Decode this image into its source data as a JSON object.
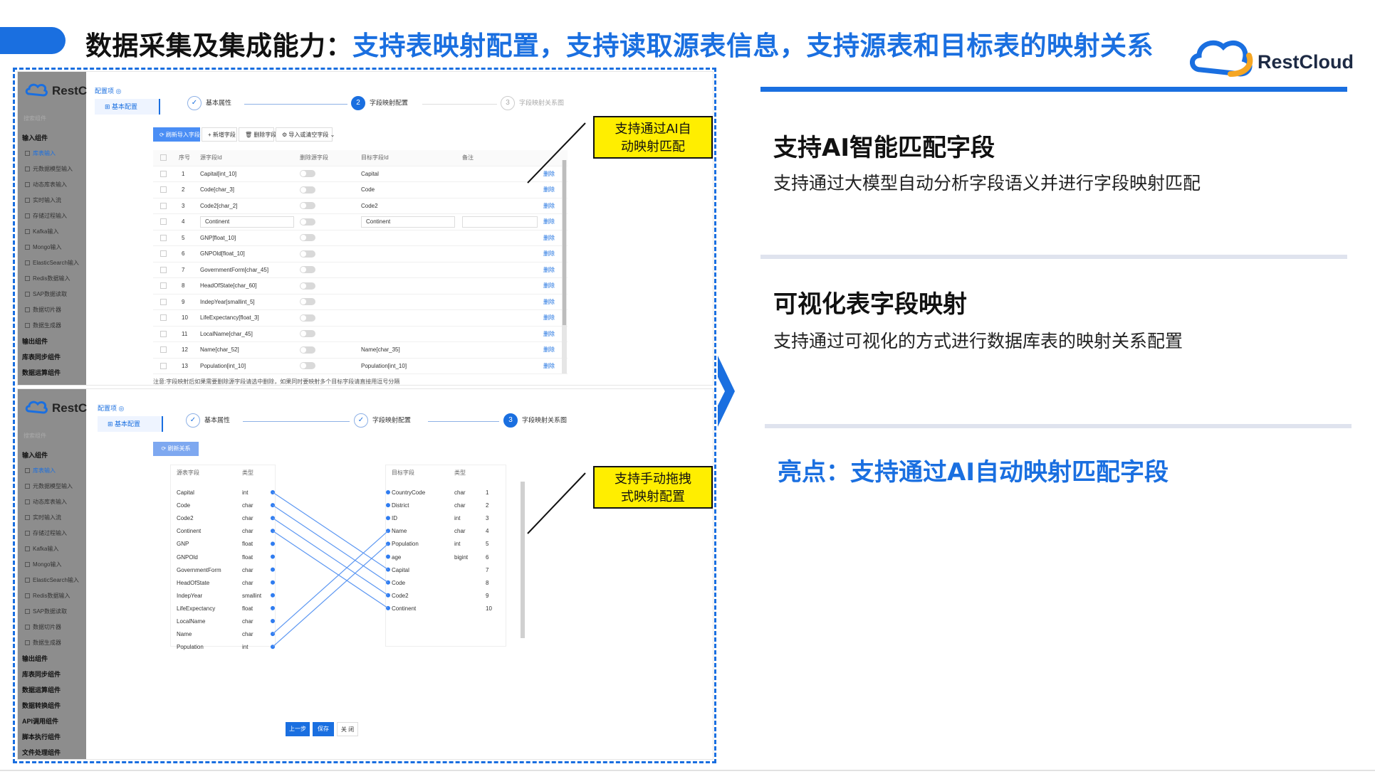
{
  "slide": {
    "title_black": "数据采集及集成能力：",
    "title_blue": "支持表映射配置，支持读取源表信息，支持源表和目标表的映射关系",
    "brand": "RestCloud",
    "colors": {
      "accent": "#1a6fe0",
      "callout": "#ffee00"
    }
  },
  "features": [
    {
      "heading": "支持AI智能匹配字段",
      "desc": "支持通过大模型自动分析字段语义并进行字段映射匹配"
    },
    {
      "heading": "可视化表字段映射",
      "desc": "支持通过可视化的方式进行数据库表的映射关系配置"
    }
  ],
  "highlight": "亮点：支持通过AI自动映射匹配字段",
  "callouts": {
    "ai_line1": "支持通过AI自",
    "ai_line2": "动映射匹配",
    "drag_line1": "支持手动拖拽",
    "drag_line2": "式映射配置"
  },
  "app": {
    "logo_text": "RestC",
    "search_placeholder": "搜索组件",
    "config_title": "配置项 ◎",
    "config_item": "基本配置",
    "sidebar": [
      {
        "label": "输入组件",
        "group": true
      },
      {
        "label": "库表输入",
        "active": true
      },
      {
        "label": "元数据模型输入"
      },
      {
        "label": "动态库表输入"
      },
      {
        "label": "实时输入流"
      },
      {
        "label": "存储过程输入"
      },
      {
        "label": "Kafka输入"
      },
      {
        "label": "Mongo输入"
      },
      {
        "label": "ElasticSearch输入"
      },
      {
        "label": "Redis数据输入"
      },
      {
        "label": "SAP数据读取"
      },
      {
        "label": "数据切片器"
      },
      {
        "label": "数据生成器"
      },
      {
        "label": "输出组件",
        "group": true
      },
      {
        "label": "库表同步组件",
        "group": true
      },
      {
        "label": "数据运算组件",
        "group": true
      }
    ],
    "sidebar2_extra": [
      {
        "label": "数据转换组件",
        "group": true
      },
      {
        "label": "API调用组件",
        "group": true
      },
      {
        "label": "脚本执行组件",
        "group": true
      },
      {
        "label": "文件处理组件",
        "group": true
      }
    ],
    "steps": [
      {
        "num": "✓",
        "label": "基本属性"
      },
      {
        "num": "2",
        "label": "字段映射配置"
      },
      {
        "num": "3",
        "label": "字段映射关系图"
      }
    ]
  },
  "shot1": {
    "toolbar": [
      "⟳ 刷新导入字段",
      "+ 新增字段",
      "🗑 删除字段",
      "⚙ 导入或清空字段 ⌄"
    ],
    "columns": [
      "序号",
      "源字段Id",
      "删除源字段",
      "目标字段Id",
      "备注"
    ],
    "rows": [
      {
        "n": "1",
        "src": "Capital[int_10]",
        "tgt": "Capital"
      },
      {
        "n": "2",
        "src": "Code[char_3]",
        "tgt": "Code"
      },
      {
        "n": "3",
        "src": "Code2[char_2]",
        "tgt": "Code2"
      },
      {
        "n": "4",
        "src": "Continent",
        "tgt": "Continent",
        "editing": true
      },
      {
        "n": "5",
        "src": "GNP[float_10]",
        "tgt": ""
      },
      {
        "n": "6",
        "src": "GNPOld[float_10]",
        "tgt": ""
      },
      {
        "n": "7",
        "src": "GovernmentForm[char_45]",
        "tgt": ""
      },
      {
        "n": "8",
        "src": "HeadOfState[char_60]",
        "tgt": ""
      },
      {
        "n": "9",
        "src": "IndepYear[smallint_5]",
        "tgt": ""
      },
      {
        "n": "10",
        "src": "LifeExpectancy[float_3]",
        "tgt": ""
      },
      {
        "n": "11",
        "src": "LocalName[char_45]",
        "tgt": ""
      },
      {
        "n": "12",
        "src": "Name[char_52]",
        "tgt": "Name[char_35]"
      },
      {
        "n": "13",
        "src": "Population[int_10]",
        "tgt": "Population[int_10]"
      }
    ],
    "row_action": "删除",
    "note": "注意:字段映射后如果需要删除源字段请选中删除，如果同时要映射多个目标字段请直接用逗号分隔"
  },
  "shot2": {
    "refresh_btn": "⟳ 刷新关系",
    "src_headers": [
      "源表字段",
      "类型"
    ],
    "tgt_headers": [
      "目标字段",
      "类型"
    ],
    "src_fields": [
      {
        "name": "Capital",
        "type": "int"
      },
      {
        "name": "Code",
        "type": "char"
      },
      {
        "name": "Code2",
        "type": "char"
      },
      {
        "name": "Continent",
        "type": "char"
      },
      {
        "name": "GNP",
        "type": "float"
      },
      {
        "name": "GNPOld",
        "type": "float"
      },
      {
        "name": "GovernmentForm",
        "type": "char"
      },
      {
        "name": "HeadOfState",
        "type": "char"
      },
      {
        "name": "IndepYear",
        "type": "smallint"
      },
      {
        "name": "LifeExpectancy",
        "type": "float"
      },
      {
        "name": "LocalName",
        "type": "char"
      },
      {
        "name": "Name",
        "type": "char"
      },
      {
        "name": "Population",
        "type": "int"
      }
    ],
    "tgt_fields": [
      {
        "name": "CountryCode",
        "type": "char",
        "n": "1"
      },
      {
        "name": "District",
        "type": "char",
        "n": "2"
      },
      {
        "name": "ID",
        "type": "int",
        "n": "3"
      },
      {
        "name": "Name",
        "type": "char",
        "n": "4"
      },
      {
        "name": "Population",
        "type": "int",
        "n": "5"
      },
      {
        "name": "age",
        "type": "bigint",
        "n": "6"
      },
      {
        "name": "Capital",
        "type": "",
        "n": "7"
      },
      {
        "name": "Code",
        "type": "",
        "n": "8"
      },
      {
        "name": "Code2",
        "type": "",
        "n": "9"
      },
      {
        "name": "Continent",
        "type": "",
        "n": "10"
      }
    ],
    "links": [
      [
        0,
        6
      ],
      [
        1,
        7
      ],
      [
        2,
        8
      ],
      [
        3,
        9
      ],
      [
        11,
        3
      ],
      [
        12,
        4
      ]
    ],
    "buttons": {
      "prev": "上一步",
      "save": "保存",
      "close": "关 闭"
    }
  }
}
